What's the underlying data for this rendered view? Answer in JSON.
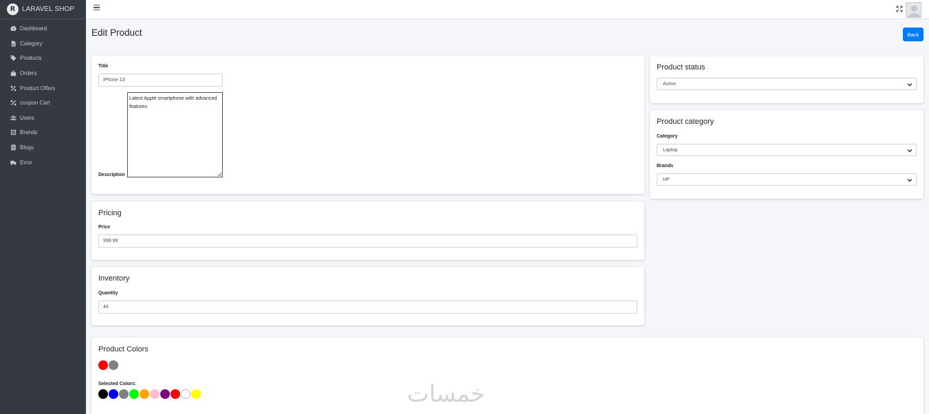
{
  "brand": {
    "name": "LARAVEL SHOP",
    "logo_letter": "R"
  },
  "sidebar": {
    "items": [
      {
        "label": "Dashboard",
        "icon": "dashboard-icon"
      },
      {
        "label": "Category",
        "icon": "file-icon"
      },
      {
        "label": "Products",
        "icon": "tag-icon"
      },
      {
        "label": "Orders",
        "icon": "shopping-bag-icon"
      },
      {
        "label": "Product Offers",
        "icon": "percent-icon"
      },
      {
        "label": "coupon Cart",
        "icon": "percent-icon"
      },
      {
        "label": "Users",
        "icon": "users-icon"
      },
      {
        "label": "Brands",
        "icon": "brand-icon"
      },
      {
        "label": "Blogs",
        "icon": "blog-icon"
      },
      {
        "label": "Error",
        "icon": "truck-icon"
      }
    ]
  },
  "header": {
    "title": "Edit Product",
    "back_label": "Back"
  },
  "product": {
    "title_label": "Title",
    "title_value": "iPhone 13",
    "description_label": "Description",
    "description_value": "Latest Apple smartphone with advanced features"
  },
  "pricing": {
    "title": "Pricing",
    "price_label": "Price",
    "price_value": "999.99"
  },
  "inventory": {
    "title": "Inventory",
    "quantity_label": "Quantity",
    "quantity_value": "44"
  },
  "status": {
    "title": "Product status",
    "selected": "Active"
  },
  "category": {
    "title": "Product category",
    "category_label": "Category",
    "category_selected": "Laptop",
    "brands_label": "Brands",
    "brands_selected": "HP"
  },
  "colors": {
    "title": "Product Colors",
    "available": [
      "#ff0000",
      "#808080"
    ],
    "selected_label": "Selected Colors:",
    "selected": [
      "#000000",
      "#0000ff",
      "#808080",
      "#00ff00",
      "#ffa500",
      "#ffc0cb",
      "#800080",
      "#ff0000",
      "#ffffff",
      "#ffff00"
    ]
  },
  "watermark": {
    "text": "خمسات"
  },
  "theme": {
    "primary": "#007bff",
    "sidebar_bg": "#343a40",
    "page_bg": "#f4f6f9"
  }
}
